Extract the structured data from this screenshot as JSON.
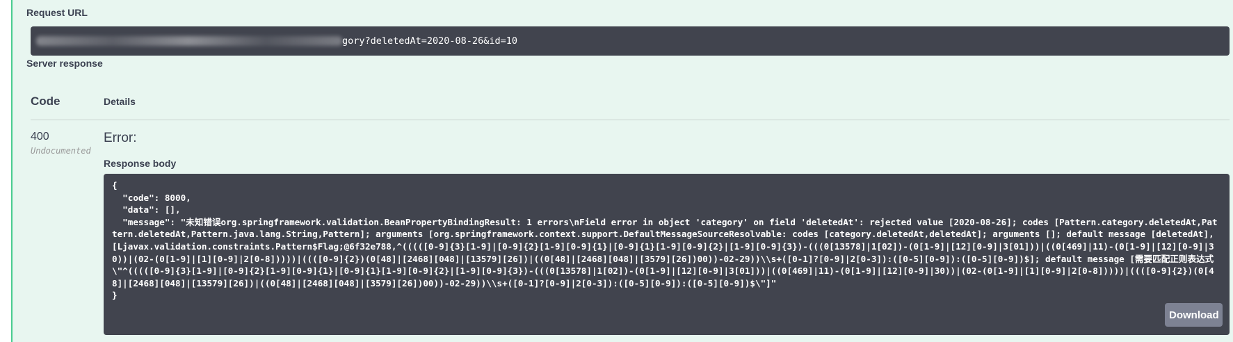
{
  "request_url": {
    "label": "Request URL",
    "visible_suffix": "gory?deletedAt=2020-08-26&id=10"
  },
  "server_response": {
    "label": "Server response",
    "headers": {
      "code": "Code",
      "details": "Details"
    },
    "row": {
      "status_code": "400",
      "status_note": "Undocumented",
      "error_label": "Error:",
      "response_body_label": "Response body",
      "response_body": "{\n  \"code\": 8000,\n  \"data\": [],\n  \"message\": \"未知错误org.springframework.validation.BeanPropertyBindingResult: 1 errors\\nField error in object 'category' on field 'deletedAt': rejected value [2020-08-26]; codes [Pattern.category.deletedAt,Pattern.deletedAt,Pattern.java.lang.String,Pattern]; arguments [org.springframework.context.support.DefaultMessageSourceResolvable: codes [category.deletedAt,deletedAt]; arguments []; default message [deletedAt],[Ljavax.validation.constraints.Pattern$Flag;@6f32e788,^(((([0-9]{3}[1-9]|[0-9]{2}[1-9][0-9]{1}|[0-9]{1}[1-9][0-9]{2}|[1-9][0-9]{3})-(((0[13578]|1[02])-(0[1-9]|[12][0-9]|3[01]))|((0[469]|11)-(0[1-9]|[12][0-9]|30))|(02-(0[1-9]|[1][0-9]|2[0-8]))))|((([0-9]{2})(0[48]|[2468][048]|[13579][26])|((0[48]|[2468][048]|[3579][26])00))-02-29))\\\\s+([0-1]?[0-9]|2[0-3]):([0-5][0-9]):([0-5][0-9])$]; default message [需要匹配正则表达式\\\"^(((([0-9]{3}[1-9]|[0-9]{2}[1-9][0-9]{1}|[0-9]{1}[1-9][0-9]{2}|[1-9][0-9]{3})-(((0[13578]|1[02])-(0[1-9]|[12][0-9]|3[01]))|((0[469]|11)-(0[1-9]|[12][0-9]|30))|(02-(0[1-9]|[1][0-9]|2[0-8]))))|((([0-9]{2})(0[48]|[2468][048]|[13579][26])|((0[48]|[2468][048]|[3579][26])00))-02-29))\\\\s+([0-1]?[0-9]|2[0-3]):([0-5][0-9]):([0-5][0-9])$\\\"]\"\n}",
      "download_label": "Download"
    }
  },
  "colors": {
    "panel_bg": "#e8f6f0",
    "accent": "#49cc90",
    "code_bg": "#41444e",
    "button_bg": "#7d8293"
  }
}
